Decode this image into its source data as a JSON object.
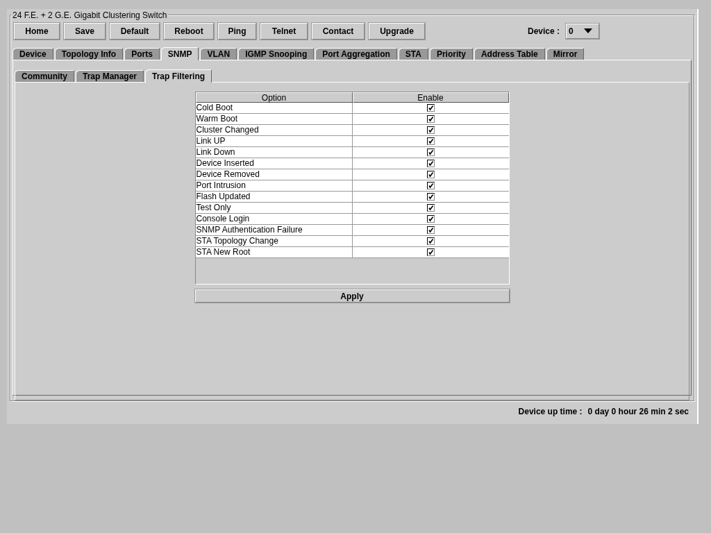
{
  "window": {
    "title": "24 F.E. + 2 G.E. Gigabit Clustering Switch"
  },
  "toolbar": [
    "Home",
    "Save",
    "Default",
    "Reboot",
    "Ping",
    "Telnet",
    "Contact",
    "Upgrade"
  ],
  "device_select": {
    "label": "Device :",
    "value": "0"
  },
  "tabs": [
    {
      "label": "Device",
      "selected": false
    },
    {
      "label": "Topology Info",
      "selected": false
    },
    {
      "label": "Ports",
      "selected": false
    },
    {
      "label": "SNMP",
      "selected": true
    },
    {
      "label": "VLAN",
      "selected": false
    },
    {
      "label": "IGMP Snooping",
      "selected": false
    },
    {
      "label": "Port Aggregation",
      "selected": false
    },
    {
      "label": "STA",
      "selected": false
    },
    {
      "label": "Priority",
      "selected": false
    },
    {
      "label": "Address Table",
      "selected": false
    },
    {
      "label": "Mirror",
      "selected": false
    }
  ],
  "subtabs": [
    {
      "label": "Community",
      "selected": false
    },
    {
      "label": "Trap Manager",
      "selected": false
    },
    {
      "label": "Trap Filtering",
      "selected": true
    }
  ],
  "table": {
    "columns": [
      "Option",
      "Enable"
    ],
    "rows": [
      {
        "option": "Cold Boot",
        "enabled": true
      },
      {
        "option": "Warm Boot",
        "enabled": true
      },
      {
        "option": "Cluster Changed",
        "enabled": true
      },
      {
        "option": "Link UP",
        "enabled": true
      },
      {
        "option": "Link Down",
        "enabled": true
      },
      {
        "option": "Device Inserted",
        "enabled": true
      },
      {
        "option": "Device Removed",
        "enabled": true
      },
      {
        "option": "Port Intrusion",
        "enabled": true
      },
      {
        "option": "Flash Updated",
        "enabled": true
      },
      {
        "option": "Test Only",
        "enabled": true
      },
      {
        "option": "Console Login",
        "enabled": true
      },
      {
        "option": "SNMP Authentication Failure",
        "enabled": true
      },
      {
        "option": "STA Topology Change",
        "enabled": true
      },
      {
        "option": "STA New Root",
        "enabled": true
      }
    ]
  },
  "apply_button": "Apply",
  "status_bar": {
    "label": "Device up time :",
    "value": "0 day 0 hour 26 min 2 sec"
  }
}
